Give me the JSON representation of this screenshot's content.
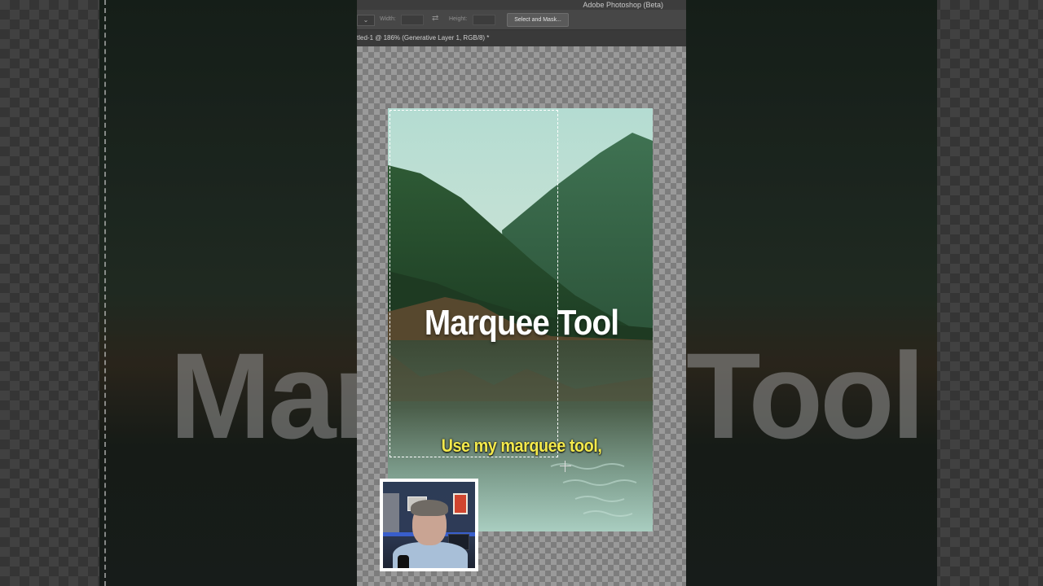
{
  "app": {
    "title": "Adobe Photoshop (Beta)"
  },
  "options_bar": {
    "style_value": "",
    "width_label": "Width:",
    "height_label": "Height:",
    "select_and_mask_label": "Select and Mask..."
  },
  "document": {
    "tab_title": "tled-1 @ 186% (Generative Layer 1, RGB/8) *"
  },
  "overlay": {
    "headline": "Marquee Tool",
    "caption": "Use my marquee tool,",
    "background_word_left": "Mar",
    "background_word_right": "Tool"
  },
  "colors": {
    "caption_yellow": "#f3e94c",
    "headline_white": "#ffffff",
    "sky": "#bfe0d6",
    "forest": "#2f5a3a",
    "water": "#6c8a78"
  },
  "icons": {
    "swap": "swap-arrows-icon",
    "crosshair": "crosshair-cursor-icon",
    "dropdown": "chevron-down-icon"
  }
}
